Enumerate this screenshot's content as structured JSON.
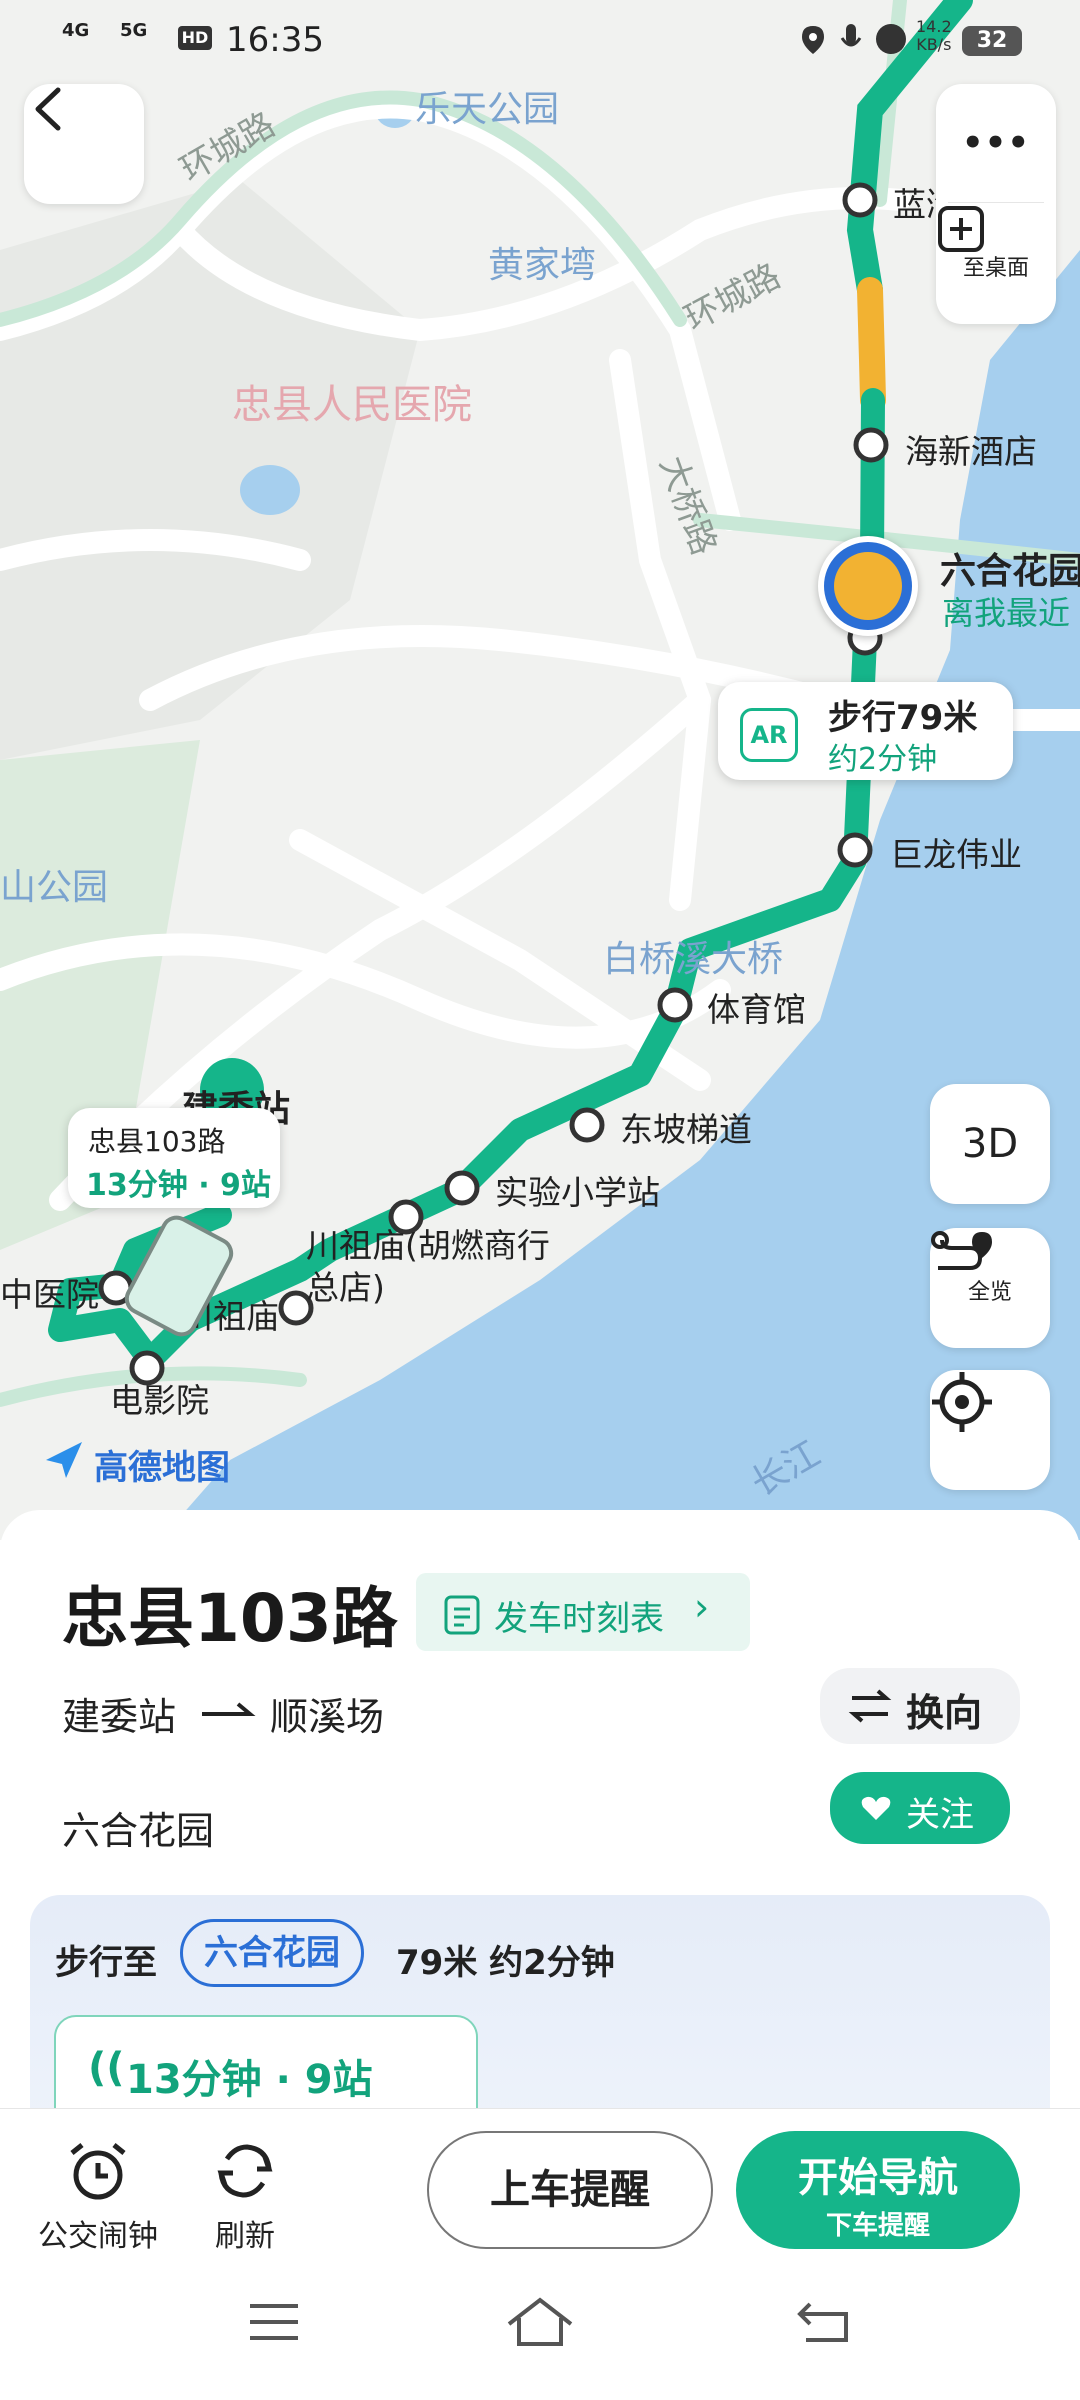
{
  "status_bar": {
    "network_left": "4G",
    "network_right": "5G",
    "hd": "HD",
    "time": "16:35",
    "speed_value": "14.2",
    "speed_unit": "KB/s",
    "battery": "32"
  },
  "map": {
    "roads": [
      "环城路",
      "环城路",
      "大桥路"
    ],
    "pois": {
      "park1": "乐天公园",
      "area1": "黄家塆",
      "hospital": "忠县人民医院",
      "park2": "山公园",
      "bridge": "白桥溪大桥",
      "river": "长江",
      "start_station": "建委站"
    },
    "stops": [
      {
        "name": "蓝湾"
      },
      {
        "name": "海新酒店"
      },
      {
        "name": "巨龙伟业"
      },
      {
        "name": "体育馆"
      },
      {
        "name": "东坡梯道"
      },
      {
        "name": "实验小学站"
      },
      {
        "name": "川祖庙(胡燃商行总店)"
      },
      {
        "name": "川祖庙"
      },
      {
        "name": "中医院"
      },
      {
        "name": "电影院"
      }
    ],
    "selected_stop": {
      "name": "六合花园",
      "sub": "离我最近"
    },
    "walk_bubble": {
      "ar": "AR",
      "title": "步行79米",
      "sub": "约2分钟"
    },
    "bus_bubble": {
      "route": "忠县103路",
      "info": "13分钟 · 9站"
    },
    "brand": "高德地图",
    "buttons": {
      "more": "•••",
      "add_desktop": "至桌面",
      "three_d": "3D",
      "overview": "全览"
    }
  },
  "sheet": {
    "route_title": "忠县103路",
    "timetable": "发车时刻表",
    "from": "建委站",
    "to": "顺溪场",
    "switch": "换向",
    "nearest_stop": "六合花园",
    "follow": "关注",
    "walk": {
      "prefix": "步行至",
      "station": "六合花园",
      "distance": "79米 约2分钟",
      "eta": "13分钟 · 9站"
    }
  },
  "actions": {
    "alarm": "公交闹钟",
    "refresh": "刷新",
    "board_remind": "上车提醒",
    "start_nav": "开始导航",
    "alight_remind": "下车提醒"
  },
  "colors": {
    "route_green": "#15b58a",
    "route_yellow": "#f2b232",
    "water": "#a6cfee",
    "accent_blue": "#2b6fd6"
  }
}
